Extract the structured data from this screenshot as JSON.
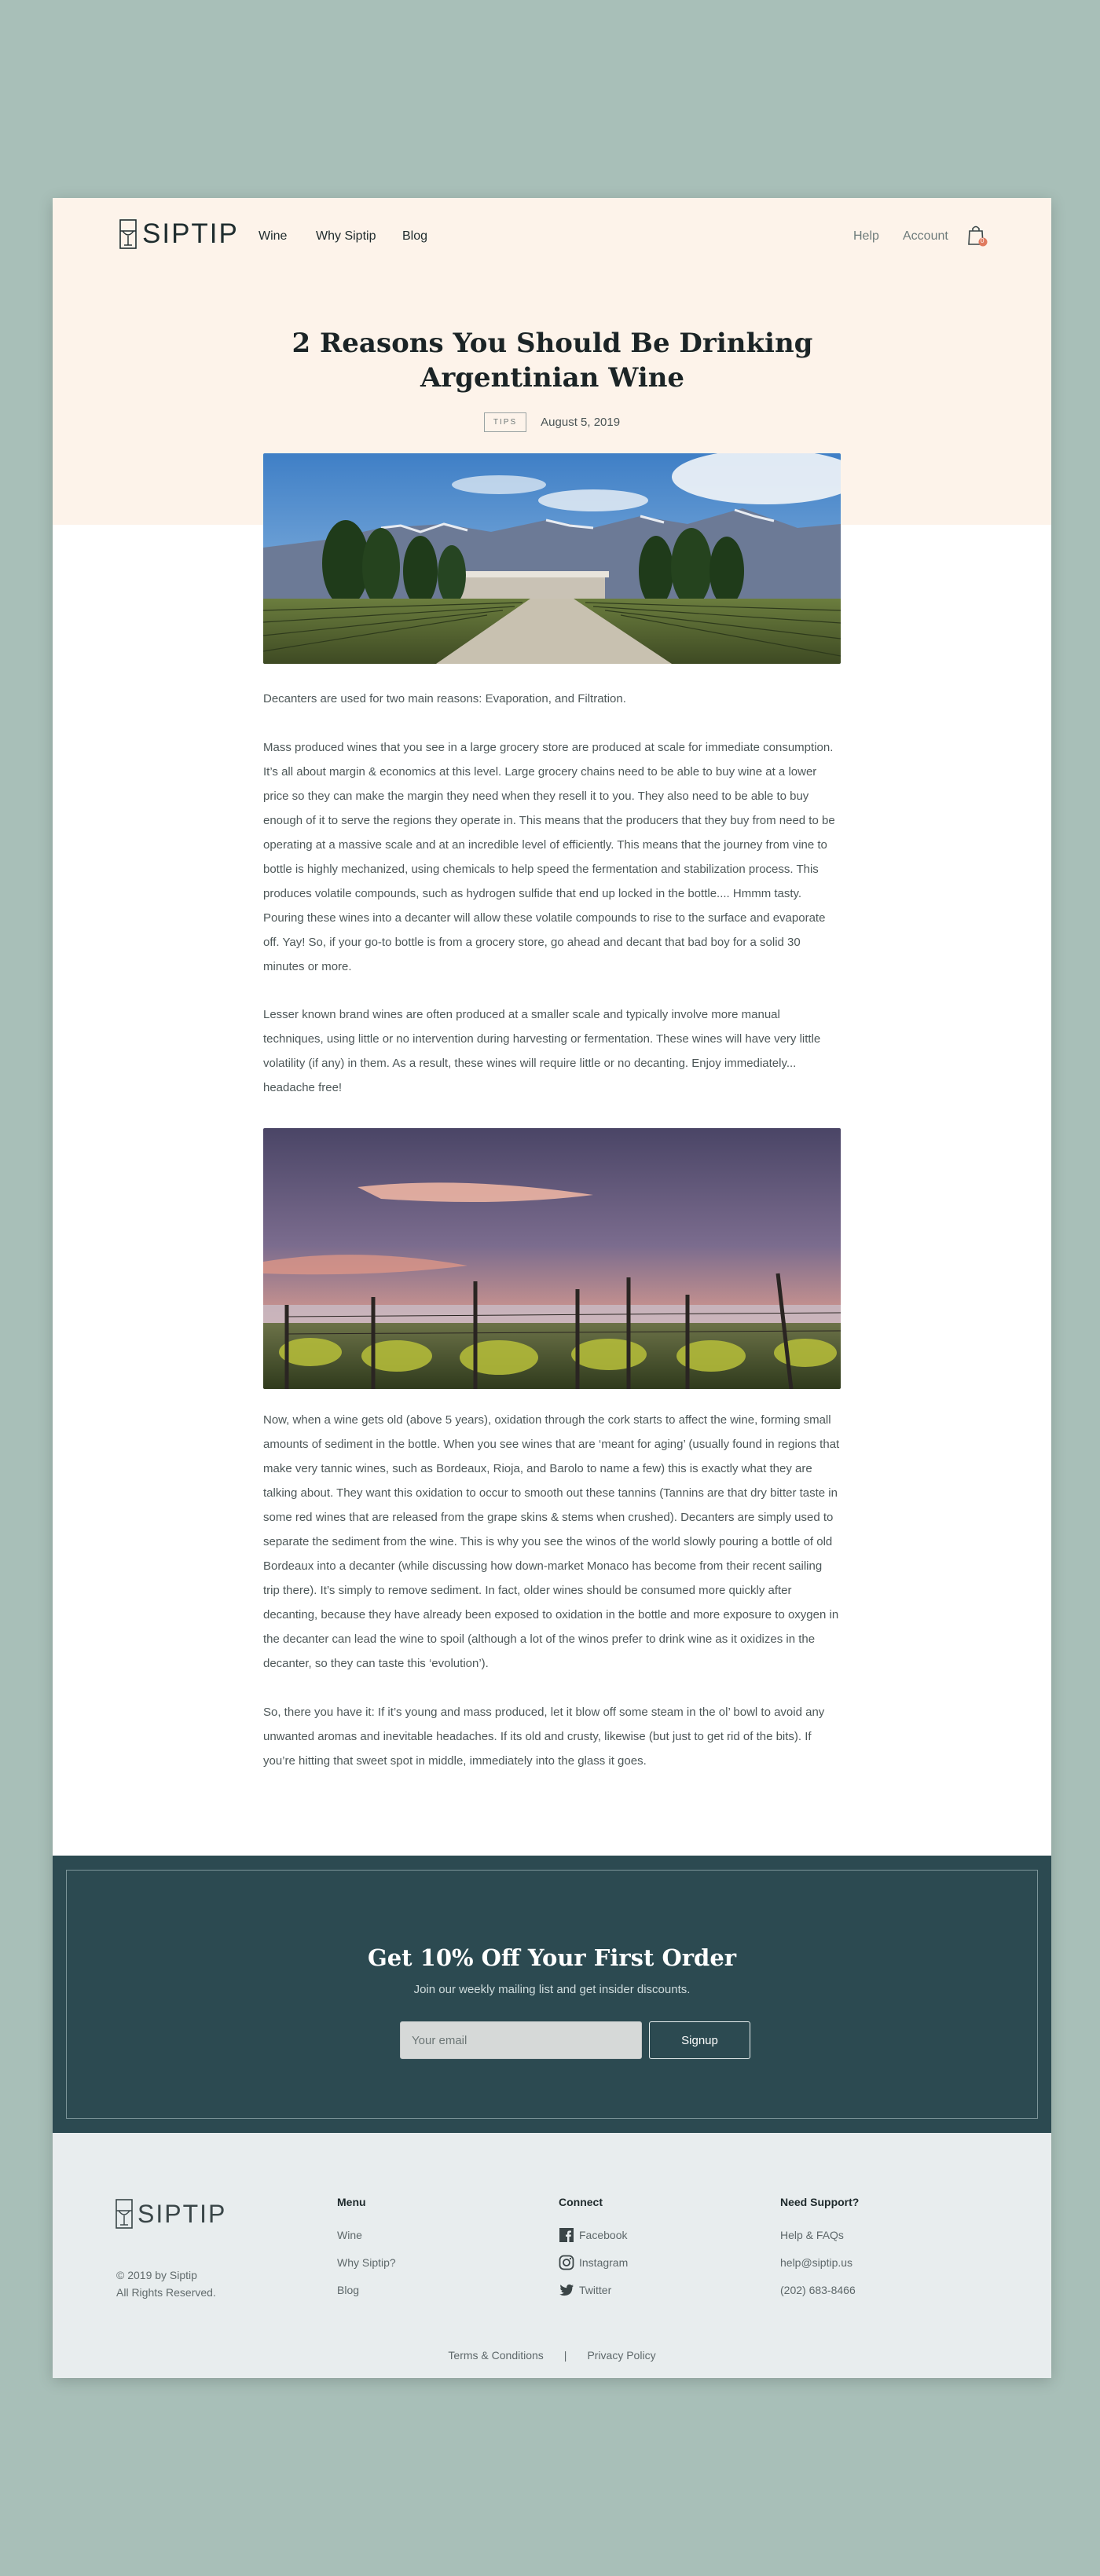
{
  "brand": {
    "name": "SIPTIP"
  },
  "nav": {
    "links": [
      "Wine",
      "Why Siptip",
      "Blog"
    ],
    "help": "Help",
    "account": "Account",
    "cart_count": "0",
    "accent": "#e07a5f"
  },
  "article": {
    "title": "2 Reasons You Should Be Drinking Argentinian Wine",
    "tag": "TIPS",
    "date": "August 5, 2019",
    "paragraphs": [
      "Decanters are used for two main reasons: Evaporation, and Filtration.",
      "Mass produced wines that you see in a large grocery store are produced at scale for immediate consumption. It’s all about margin & economics at this level. Large grocery chains need to be able to buy wine at a lower price so they can make the margin they need when they resell it to you. They also need to be able to buy enough of it to serve the regions they operate in. This means that the producers that they buy from need to be operating at a massive scale and at an incredible level of efficiently. This means that the journey from vine to bottle is highly mechanized, using chemicals to help speed the fermentation and stabilization process. This produces volatile compounds, such as hydrogen sulfide that end up locked in the bottle.... Hmmm tasty. Pouring these wines into a decanter will allow these volatile compounds to rise to the surface and evaporate off. Yay! So, if your go-to bottle is from a grocery store, go ahead and decant that bad boy for a solid 30 minutes or more.",
      "Lesser known brand wines are often produced at a smaller scale and typically involve more manual techniques, using little or no intervention during harvesting or fermentation. These wines will have very little volatility (if any) in them. As a result, these wines will require little or no decanting. Enjoy immediately... headache free!",
      "Now, when a wine gets old (above 5 years), oxidation through the cork starts to affect the wine, forming small amounts of sediment in the bottle. When you see wines that are ‘meant for aging’ (usually found in regions that make very tannic wines, such as Bordeaux, Rioja, and Barolo to name a few) this is exactly what they are talking about. They want this oxidation to occur to smooth out these tannins (Tannins are that dry bitter taste in some red wines that are released from the grape skins & stems when crushed). Decanters are simply used to separate the sediment from the wine. This is why you see the winos of the world slowly pouring a bottle of old Bordeaux into a decanter (while discussing how down-market Monaco has become from their recent sailing trip there). It’s simply to remove sediment. In fact, older wines should be consumed more quickly after decanting, because they have already been exposed to oxidation in the bottle and more exposure to oxygen in the decanter can lead the wine to spoil (although a lot of the winos prefer to drink wine as it oxidizes in the decanter, so they can taste this ‘evolution’).",
      "So, there you have it: If it’s young and mass produced, let it blow off some steam in the ol’ bowl to avoid any unwanted aromas and inevitable headaches. If its old and crusty, likewise (but just to get rid of the bits). If you’re hitting that sweet spot in middle, immediately into the glass it goes."
    ]
  },
  "newsletter": {
    "title": "Get 10% Off Your First Order",
    "subtitle": "Join our weekly mailing list and get insider discounts.",
    "placeholder": "Your email",
    "button": "Signup"
  },
  "footer": {
    "copyright": "© 2019 by Siptip",
    "rights": "All Rights Reserved.",
    "menu": {
      "heading": "Menu",
      "items": [
        "Wine",
        "Why Siptip?",
        "Blog"
      ]
    },
    "connect": {
      "heading": "Connect",
      "items": [
        "Facebook",
        "Instagram",
        "Twitter"
      ]
    },
    "support": {
      "heading": "Need Support?",
      "items": [
        "Help & FAQs",
        "help@siptip.us",
        "(202) 683-8466"
      ]
    },
    "terms": "Terms & Conditions",
    "separator": "|",
    "privacy": "Privacy Policy"
  }
}
